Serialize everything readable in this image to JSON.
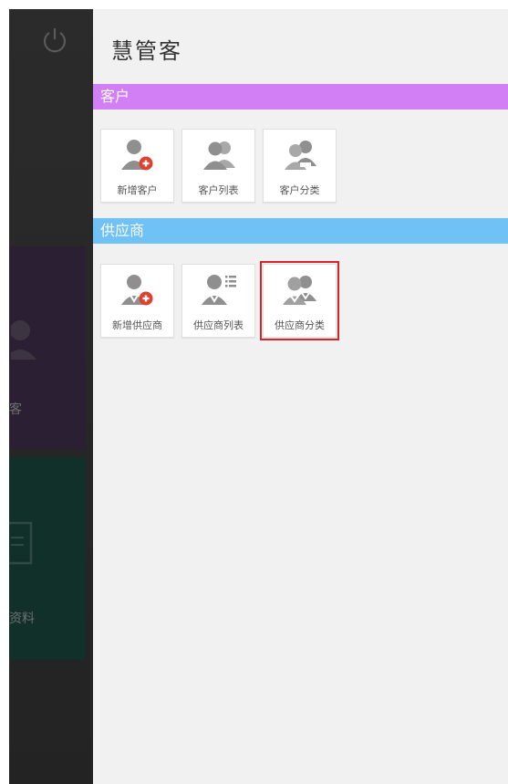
{
  "background_app": {
    "tile_customer_label": "客",
    "tile_data_label": "资料"
  },
  "drawer": {
    "title": "慧管客",
    "sections": [
      {
        "name": "customer",
        "label": "客户",
        "color": "#d27ff5",
        "items": [
          {
            "label": "新增客户",
            "icon": "add-customer-icon"
          },
          {
            "label": "客户列表",
            "icon": "customer-list-icon"
          },
          {
            "label": "客户分类",
            "icon": "customer-category-icon"
          }
        ]
      },
      {
        "name": "supplier",
        "label": "供应商",
        "color": "#6fc1f6",
        "items": [
          {
            "label": "新增供应商",
            "icon": "add-supplier-icon"
          },
          {
            "label": "供应商列表",
            "icon": "supplier-list-icon"
          },
          {
            "label": "供应商分类",
            "icon": "supplier-category-icon",
            "selected": true
          }
        ]
      }
    ]
  },
  "colors": {
    "selection_outline": "#d8232a",
    "icon_gray": "#8f8f8f",
    "add_badge_red": "#e0402e"
  }
}
